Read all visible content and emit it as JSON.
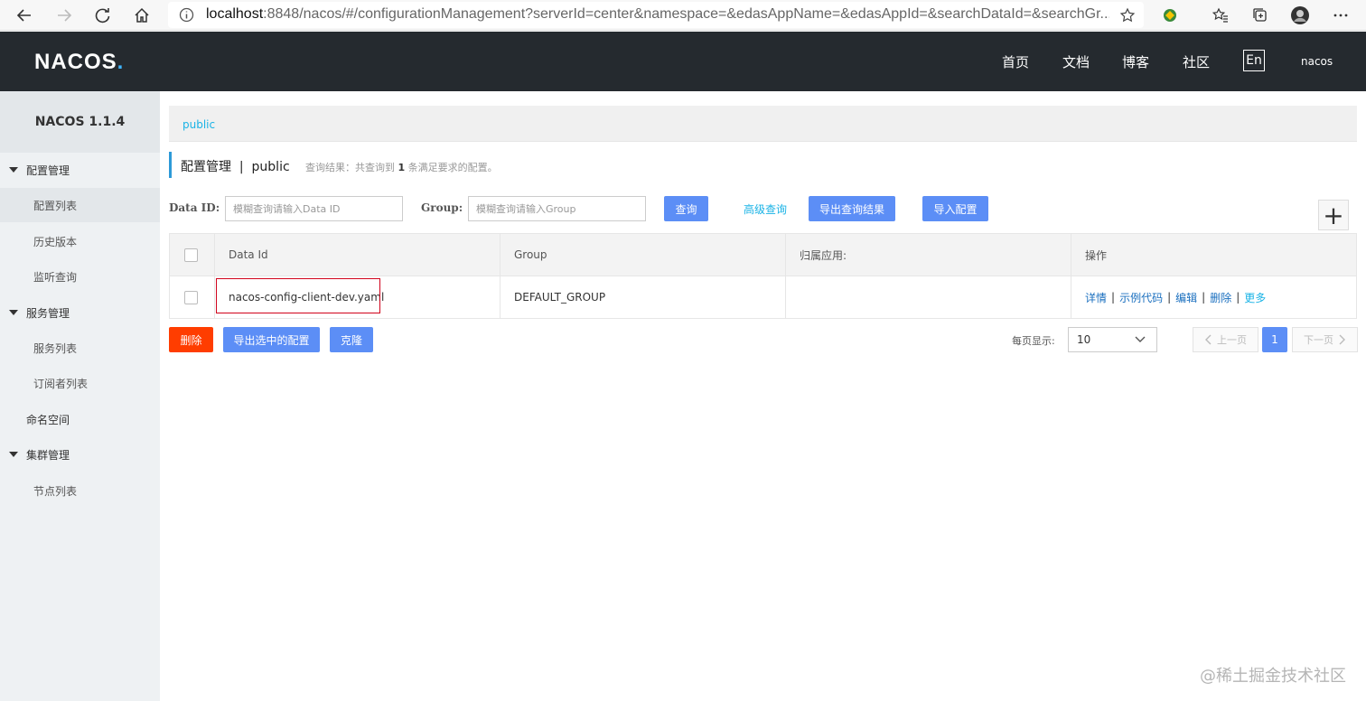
{
  "browser": {
    "url_host": "localhost",
    "url_rest": ":8848/nacos/#/configurationManagement?serverId=center&namespace=&edasAppName=&edasAppId=&searchDataId=&searchGr..."
  },
  "header": {
    "logo_main": "NACOS",
    "logo_dot": ".",
    "nav": [
      "首页",
      "文档",
      "博客",
      "社区"
    ],
    "lang": "En",
    "user": "nacos"
  },
  "sidebar": {
    "title": "NACOS 1.1.4",
    "groups": [
      {
        "label": "配置管理",
        "items": [
          "配置列表",
          "历史版本",
          "监听查询"
        ]
      },
      {
        "label": "服务管理",
        "items": [
          "服务列表",
          "订阅者列表"
        ]
      },
      {
        "label": "命名空间"
      },
      {
        "label": "集群管理",
        "items": [
          "节点列表"
        ]
      }
    ]
  },
  "main": {
    "breadcrumb": "public",
    "title": "配置管理",
    "title_sep": "|",
    "title_ns": "public",
    "result_prefix": "查询结果：共查询到",
    "result_count": "1",
    "result_suffix": "条满足要求的配置。",
    "search": {
      "dataid_label": "Data ID:",
      "dataid_placeholder": "模糊查询请输入Data ID",
      "group_label": "Group:",
      "group_placeholder": "模糊查询请输入Group",
      "query_btn": "查询",
      "advanced": "高级查询",
      "export_btn": "导出查询结果",
      "import_btn": "导入配置",
      "add_btn": "+"
    },
    "table": {
      "headers": [
        "Data Id",
        "Group",
        "归属应用:",
        "操作"
      ],
      "rows": [
        {
          "data_id": "nacos-config-client-dev.yaml",
          "group": "DEFAULT_GROUP",
          "app": "",
          "ops": [
            "详情",
            "示例代码",
            "编辑",
            "删除",
            "更多"
          ]
        }
      ],
      "op_sep": "|"
    },
    "bottom": {
      "delete_btn": "删除",
      "export_sel_btn": "导出选中的配置",
      "clone_btn": "克隆",
      "per_page_label": "每页显示:",
      "per_page_value": "10",
      "prev": "上一页",
      "page": "1",
      "next": "下一页"
    }
  },
  "watermark": "@稀土掘金技术社区"
}
